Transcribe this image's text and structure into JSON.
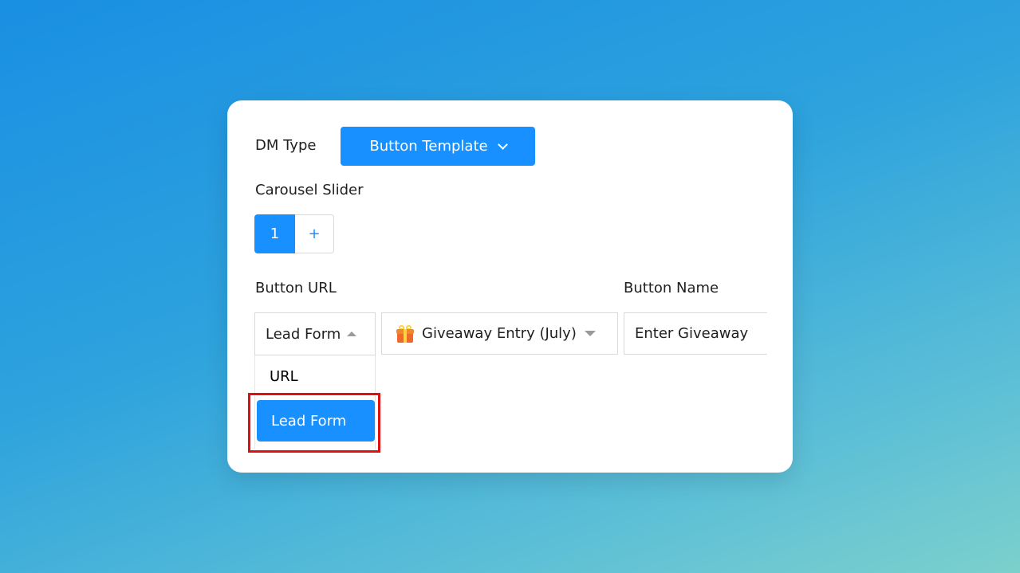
{
  "dm_type": {
    "label": "DM Type",
    "selected": "Button Template"
  },
  "carousel": {
    "label": "Carousel Slider",
    "slides": [
      "1"
    ],
    "add_label": "+"
  },
  "button_url": {
    "label": "Button URL",
    "type_select": {
      "selected": "Lead Form",
      "options": [
        "URL",
        "Lead Form"
      ]
    },
    "form_select": {
      "selected": "Giveaway Entry (July)",
      "icon": "gift-icon"
    }
  },
  "button_name": {
    "label": "Button Name",
    "value": "Enter Giveaway"
  },
  "colors": {
    "accent": "#1890ff",
    "highlight": "#e01010"
  }
}
